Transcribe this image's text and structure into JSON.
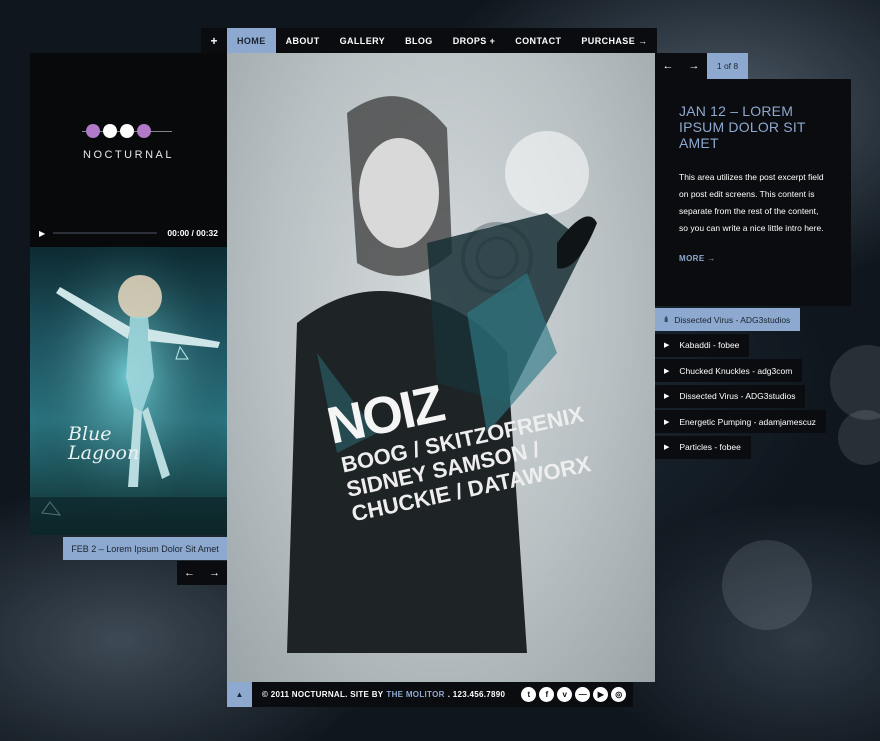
{
  "nav": {
    "plus": "+",
    "items": [
      {
        "label": "HOME",
        "active": true
      },
      {
        "label": "ABOUT"
      },
      {
        "label": "GALLERY"
      },
      {
        "label": "BLOG"
      },
      {
        "label": "DROPS +"
      },
      {
        "label": "CONTACT"
      },
      {
        "label": "PURCHASE →"
      }
    ]
  },
  "logo": {
    "name": "NOCTURNAL",
    "dot_colors": [
      "#b07ac9",
      "#ffffff",
      "#ffffff",
      "#b07ac9"
    ]
  },
  "player": {
    "play_icon": "play-icon",
    "time": "00:00 / 00:32",
    "progress": 0
  },
  "left_post": {
    "art_text_line1": "Blue",
    "art_text_line2": "Lagoon",
    "caption": "FEB 2 – Lorem Ipsum Dolor Sit Amet",
    "prev": "←",
    "next": "→"
  },
  "poster": {
    "headline": "NOIZ",
    "line1": "BOOG / SKITZOFRENIX",
    "line2": "SIDNEY SAMSON /",
    "line3": "CHUCKIE / DATAWORX"
  },
  "footer": {
    "up": "▲",
    "copyright": "© 2011 NOCTURNAL. SITE BY",
    "site_by": "THE MOLITOR",
    "phone": ". 123.456.7890",
    "socials": [
      "t",
      "f",
      "v",
      "—",
      "▶",
      "◎"
    ]
  },
  "right": {
    "prev": "←",
    "next": "→",
    "counter": "1 of 8",
    "post_title": "JAN 12 – LOREM IPSUM DOLOR SIT AMET",
    "post_excerpt": "This area utilizes the post excerpt field on post edit screens. This content is separate from the rest of the content, so you can write a nice little intro here.",
    "more": "MORE →"
  },
  "playlist": [
    {
      "title": "Dissected Virus - ADG3studios",
      "now_playing": true
    },
    {
      "title": "Kabaddi - fobee"
    },
    {
      "title": "Chucked Knuckles - adg3com"
    },
    {
      "title": "Dissected Virus - ADG3studios"
    },
    {
      "title": "Energetic Pumping - adamjamescuz"
    },
    {
      "title": "Particles - fobee"
    }
  ],
  "colors": {
    "accent": "#8ea9cf",
    "panel": "#0a0c0f",
    "logo_purple": "#b07ac9"
  }
}
